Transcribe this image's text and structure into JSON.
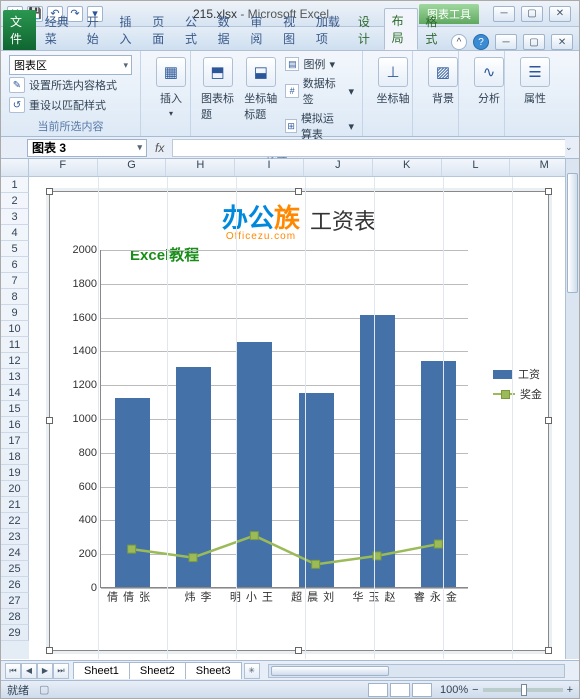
{
  "window": {
    "doc_name": "215.xlsx",
    "app_name": "Microsoft Excel",
    "context_tab": "图表工具"
  },
  "qat": [
    "save-icon",
    "undo-icon",
    "redo-icon",
    "print-icon"
  ],
  "tabs": {
    "file": "文件",
    "list": [
      "经典菜",
      "开始",
      "插入",
      "页面",
      "公式",
      "数据",
      "审阅",
      "视图",
      "加载项",
      "设计",
      "布局",
      "格式"
    ],
    "active": "布局"
  },
  "ribbon": {
    "sel_dropdown": "图表区",
    "fmt_sel": "设置所选内容格式",
    "reset": "重设以匹配样式",
    "group1": "当前所选内容",
    "insert": "插入",
    "chart_title": "图表标题",
    "axis_title": "坐标轴标题",
    "legend": "图例",
    "data_labels": "数据标签",
    "data_table": "模拟运算表",
    "group_labels": "标签",
    "axes": "坐标轴",
    "bg": "背景",
    "analysis": "分析",
    "props": "属性"
  },
  "namebox": "图表 3",
  "fx_label": "fx",
  "columns": [
    "F",
    "G",
    "H",
    "I",
    "J",
    "K",
    "L",
    "M"
  ],
  "row_start": 1,
  "row_end": 29,
  "sheets": [
    "Sheet1",
    "Sheet2",
    "Sheet3"
  ],
  "status": "就绪",
  "zoom": "100%",
  "logo_left": "办公",
  "logo_right": "族",
  "logo_sub": "Officezu.com",
  "subtitle": "Excel教程",
  "chart_data": {
    "type": "bar+line",
    "title": "工资表",
    "categories": [
      "张倩倩",
      "李炜",
      "王小明",
      "刘晨超",
      "赵玉华",
      "金永睿"
    ],
    "series": [
      {
        "name": "工资",
        "type": "bar",
        "values": [
          1120,
          1300,
          1450,
          1150,
          1610,
          1340
        ],
        "color": "#4472a8"
      },
      {
        "name": "奖金",
        "type": "line",
        "values": [
          230,
          180,
          310,
          140,
          190,
          260
        ],
        "color": "#9bbb59"
      }
    ],
    "ylim": [
      0,
      2000
    ],
    "ystep": 200
  }
}
